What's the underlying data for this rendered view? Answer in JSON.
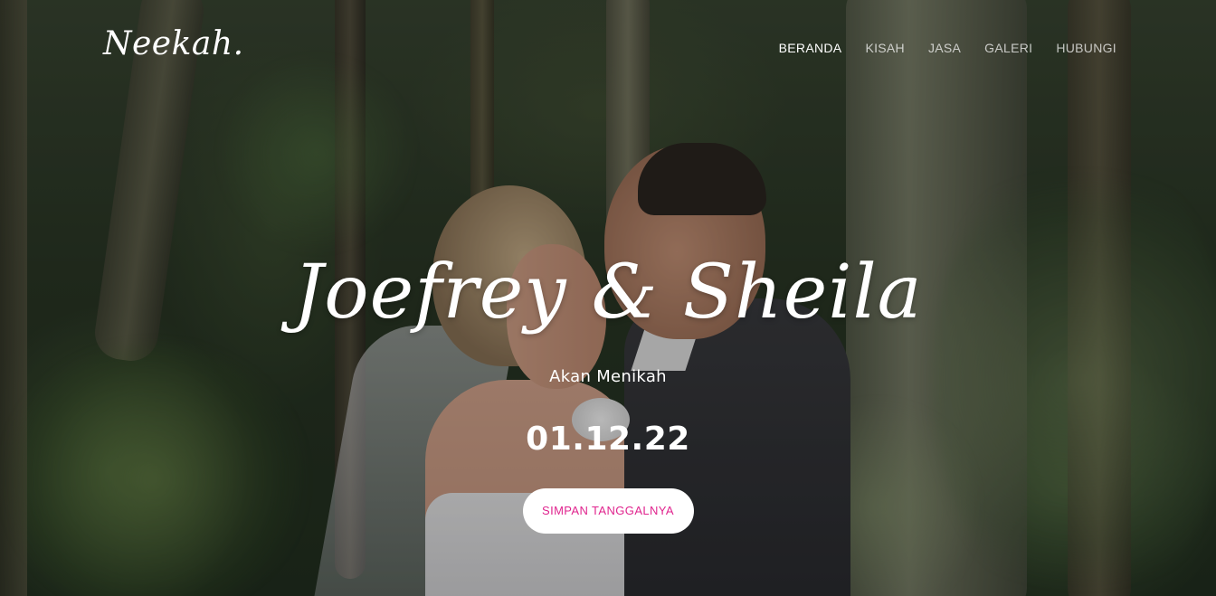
{
  "brand": {
    "logo_text": "Neekah."
  },
  "nav": {
    "items": [
      {
        "label": "BERANDA",
        "active": true
      },
      {
        "label": "KISAH",
        "active": false
      },
      {
        "label": "JASA",
        "active": false
      },
      {
        "label": "GALERI",
        "active": false
      },
      {
        "label": "HUBUNGI",
        "active": false
      }
    ]
  },
  "hero": {
    "names": "Joefrey & Sheila",
    "subtitle": "Akan Menikah",
    "date": "01.12.22",
    "cta_label": "SIMPAN TANGGALNYA"
  },
  "colors": {
    "accent": "#e0248e",
    "button_bg": "#ffffff",
    "text": "#ffffff"
  }
}
